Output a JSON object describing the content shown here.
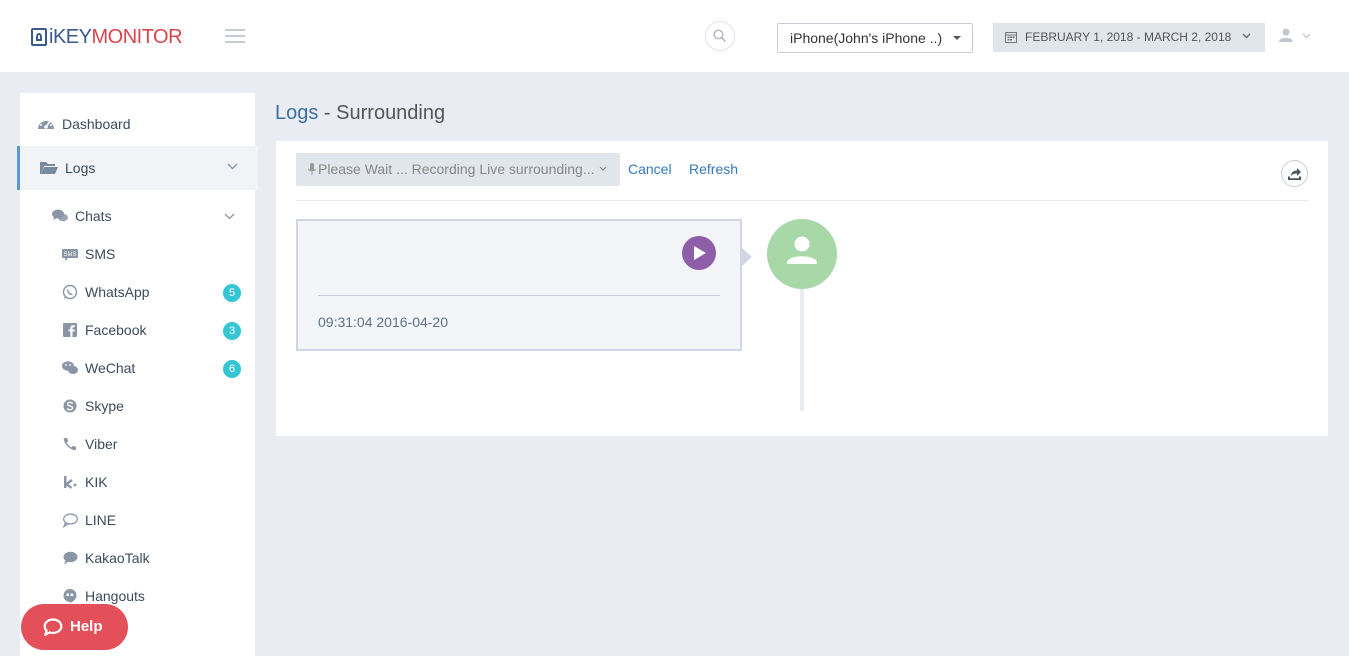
{
  "header": {
    "logo": {
      "i": "i",
      "key": "KEY",
      "monitor": "MONITOR"
    },
    "device_select": "iPhone(John's iPhone ..)",
    "date_range": "FEBRUARY 1, 2018 - MARCH 2, 2018"
  },
  "sidebar": {
    "dashboard": "Dashboard",
    "logs": "Logs",
    "chats": "Chats",
    "items": [
      {
        "label": "SMS",
        "icon": "sms-icon"
      },
      {
        "label": "WhatsApp",
        "icon": "whatsapp-icon",
        "badge": "5"
      },
      {
        "label": "Facebook",
        "icon": "facebook-icon",
        "badge": "3"
      },
      {
        "label": "WeChat",
        "icon": "wechat-icon",
        "badge": "6"
      },
      {
        "label": "Skype",
        "icon": "skype-icon"
      },
      {
        "label": "Viber",
        "icon": "viber-icon"
      },
      {
        "label": "KIK",
        "icon": "kik-icon"
      },
      {
        "label": "LINE",
        "icon": "line-icon"
      },
      {
        "label": "KakaoTalk",
        "icon": "kakaotalk-icon"
      },
      {
        "label": "Hangouts",
        "icon": "hangouts-icon"
      }
    ]
  },
  "help": {
    "label": "Help"
  },
  "main": {
    "title_section": "Logs",
    "title_separator": " - ",
    "title_page": "Surrounding",
    "recording_status": "Please Wait ... Recording Live surrounding...",
    "cancel_label": "Cancel",
    "refresh_label": "Refresh",
    "entry": {
      "timestamp": "09:31:04 2016-04-20"
    }
  },
  "colors": {
    "accent": "#337ab7",
    "badge": "#36c6d3",
    "help": "#e4505a",
    "play": "#8e5fa8",
    "avatar": "#a8d8a8",
    "logo_red": "#d9454d",
    "logo_blue": "#3a5a8c"
  }
}
